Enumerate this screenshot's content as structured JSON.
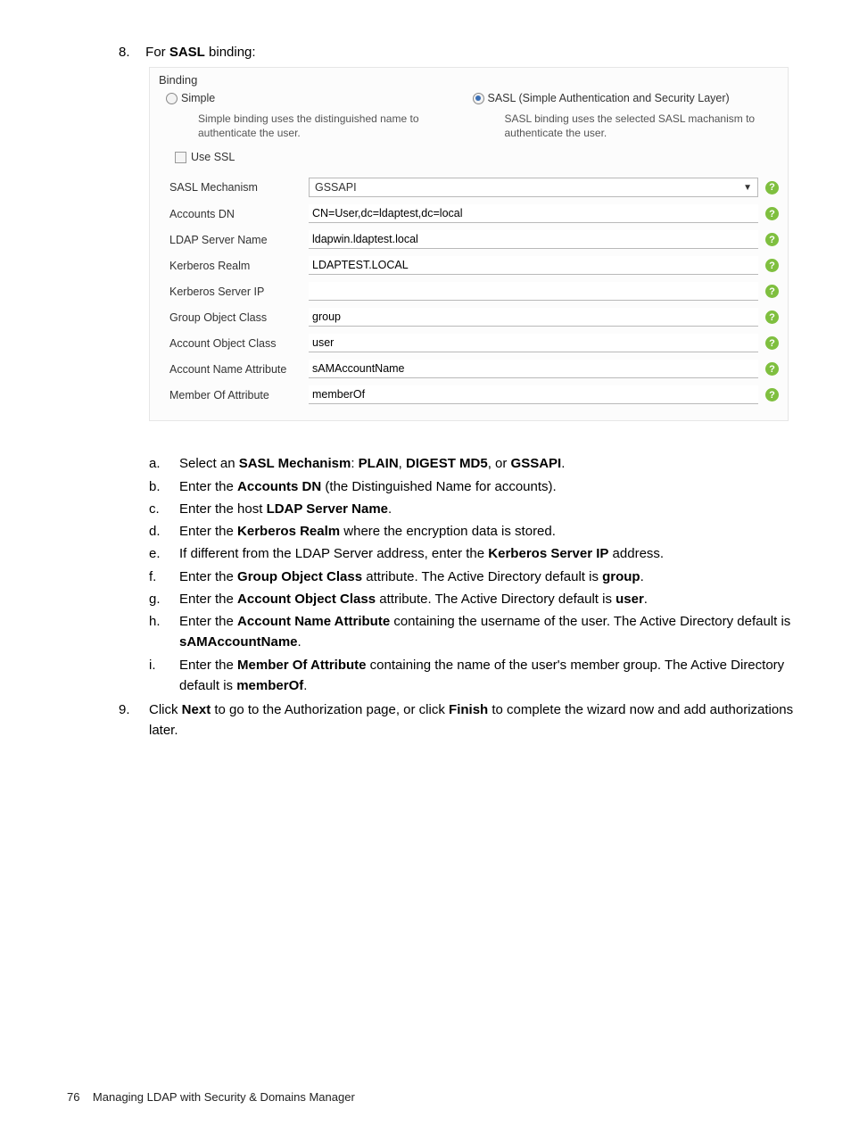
{
  "step8": {
    "num": "8.",
    "prefix": "For ",
    "bold": "SASL",
    "suffix": " binding:"
  },
  "panel": {
    "title": "Binding",
    "simple": {
      "label": "Simple",
      "desc": "Simple binding uses the distinguished name to authenticate the user."
    },
    "sasl": {
      "label": "SASL (Simple Authentication and Security Layer)",
      "desc": "SASL binding uses the selected SASL machanism to authenticate the user."
    },
    "use_ssl": "Use SSL",
    "rows": [
      {
        "label": "SASL Mechanism",
        "value": "GSSAPI",
        "type": "select"
      },
      {
        "label": "Accounts DN",
        "value": "CN=User,dc=ldaptest,dc=local",
        "type": "text"
      },
      {
        "label": "LDAP Server Name",
        "value": "ldapwin.ldaptest.local",
        "type": "text"
      },
      {
        "label": "Kerberos Realm",
        "value": "LDAPTEST.LOCAL",
        "type": "text"
      },
      {
        "label": "Kerberos Server IP",
        "value": "",
        "type": "text"
      },
      {
        "label": "Group Object Class",
        "value": "group",
        "type": "text"
      },
      {
        "label": "Account Object Class",
        "value": "user",
        "type": "text"
      },
      {
        "label": "Account Name Attribute",
        "value": "sAMAccountName",
        "type": "text"
      },
      {
        "label": "Member Of Attribute",
        "value": "memberOf",
        "type": "text"
      }
    ]
  },
  "sub": [
    {
      "l": "a.",
      "html": "Select an <b>SASL Mechanism</b>: <b>PLAIN</b>, <b>DIGEST MD5</b>, or <b>GSSAPI</b>."
    },
    {
      "l": "b.",
      "html": "Enter the <b>Accounts DN</b> (the Distinguished Name for accounts)."
    },
    {
      "l": "c.",
      "html": "Enter the host <b>LDAP Server Name</b>."
    },
    {
      "l": "d.",
      "html": "Enter the <b>Kerberos Realm</b> where the encryption data is stored."
    },
    {
      "l": "e.",
      "html": "If different from the LDAP Server address, enter the <b>Kerberos Server IP</b> address."
    },
    {
      "l": "f.",
      "html": "Enter the <b>Group Object Class</b> attribute. The Active Directory default is <b>group</b>."
    },
    {
      "l": "g.",
      "html": "Enter the <b>Account Object Class</b> attribute. The Active Directory default is <b>user</b>."
    },
    {
      "l": "h.",
      "html": "Enter the <b>Account Name Attribute</b> containing the username of the user. The Active Directory default is <b>sAMAccountName</b>."
    },
    {
      "l": "i.",
      "html": "Enter the <b>Member Of Attribute</b> containing the name of the user's member group. The Active Directory default is <b>memberOf</b>."
    }
  ],
  "step9": {
    "num": "9.",
    "html": "Click <b>Next</b> to go to the Authorization page, or click <b>Finish</b> to complete the wizard now and add authorizations later."
  },
  "footer": {
    "page": "76",
    "title": "Managing LDAP with Security & Domains Manager"
  }
}
